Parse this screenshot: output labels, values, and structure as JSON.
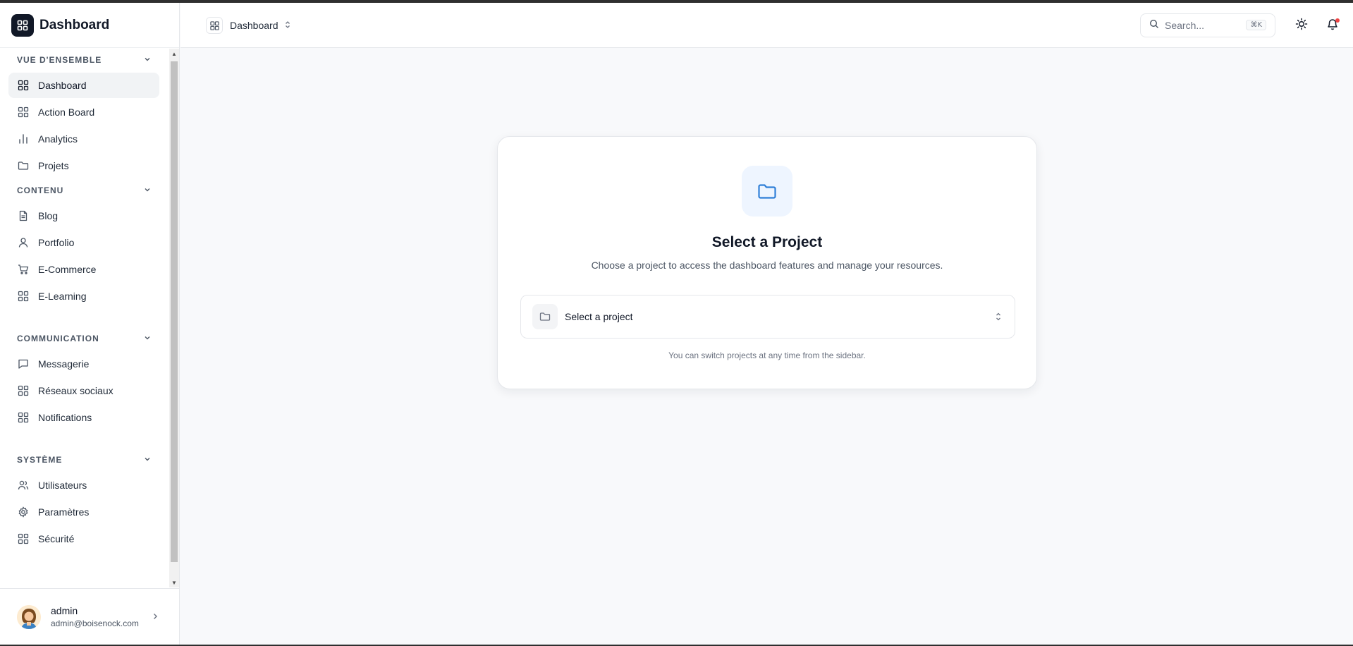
{
  "app": {
    "title": "Dashboard"
  },
  "sidebar": {
    "sections": [
      {
        "title": "VUE D'ENSEMBLE",
        "items": [
          {
            "label": "Dashboard",
            "icon": "grid-icon",
            "active": true
          },
          {
            "label": "Action Board",
            "icon": "grid-icon"
          },
          {
            "label": "Analytics",
            "icon": "bar-chart-icon"
          },
          {
            "label": "Projets",
            "icon": "folder-icon"
          }
        ]
      },
      {
        "title": "CONTENU",
        "items": [
          {
            "label": "Blog",
            "icon": "document-icon"
          },
          {
            "label": "Portfolio",
            "icon": "user-icon"
          },
          {
            "label": "E-Commerce",
            "icon": "cart-icon"
          },
          {
            "label": "E-Learning",
            "icon": "grid-icon"
          }
        ]
      },
      {
        "title": "COMMUNICATION",
        "items": [
          {
            "label": "Messagerie",
            "icon": "message-icon"
          },
          {
            "label": "Réseaux sociaux",
            "icon": "grid-icon"
          },
          {
            "label": "Notifications",
            "icon": "grid-icon"
          }
        ]
      },
      {
        "title": "SYSTÈME",
        "items": [
          {
            "label": "Utilisateurs",
            "icon": "users-icon"
          },
          {
            "label": "Paramètres",
            "icon": "gear-icon"
          },
          {
            "label": "Sécurité",
            "icon": "grid-icon"
          }
        ]
      }
    ]
  },
  "user": {
    "name": "admin",
    "email": "admin@boisenock.com"
  },
  "header": {
    "breadcrumb": "Dashboard",
    "search_placeholder": "Search...",
    "search_shortcut": "⌘K"
  },
  "main": {
    "card_title": "Select a Project",
    "card_description": "Choose a project to access the dashboard features and manage your resources.",
    "select_label": "Select a project",
    "hint": "You can switch projects at any time from the sidebar."
  },
  "colors": {
    "accent": "#2f7fd8",
    "brand": "#111827",
    "notification_dot": "#ef4444",
    "background": "#f8f9fb"
  }
}
